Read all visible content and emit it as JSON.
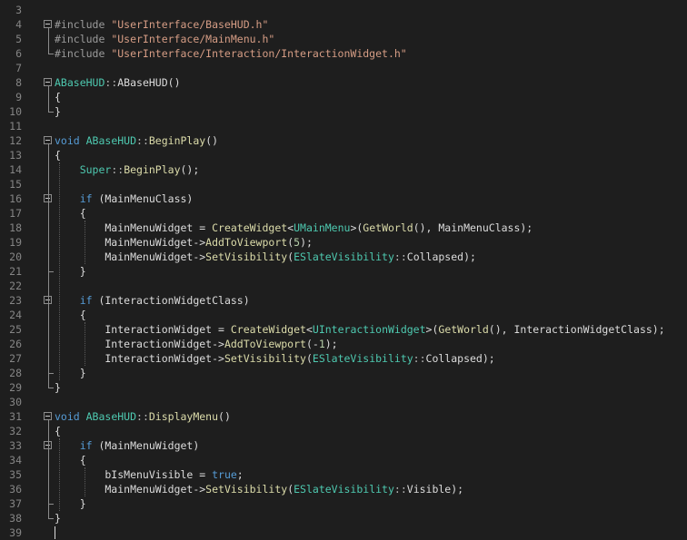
{
  "editor": {
    "lines": [
      {
        "num": "3",
        "segments": []
      },
      {
        "num": "4",
        "fold": true,
        "segments": [
          {
            "t": "#include ",
            "c": "pre"
          },
          {
            "t": "\"UserInterface/BaseHUD.h\"",
            "c": "str"
          }
        ]
      },
      {
        "num": "5",
        "segments": [
          {
            "t": "#include ",
            "c": "pre"
          },
          {
            "t": "\"UserInterface/MainMenu.h\"",
            "c": "str"
          }
        ]
      },
      {
        "num": "6",
        "segments": [
          {
            "t": "#include ",
            "c": "pre"
          },
          {
            "t": "\"UserInterface/Interaction/InteractionWidget.h\"",
            "c": "str"
          }
        ]
      },
      {
        "num": "7",
        "segments": []
      },
      {
        "num": "8",
        "fold": true,
        "segments": [
          {
            "t": "ABaseHUD",
            "c": "type"
          },
          {
            "t": "::",
            "c": "op"
          },
          {
            "t": "ABaseHUD",
            "c": "txt"
          },
          {
            "t": "()",
            "c": "txt"
          }
        ]
      },
      {
        "num": "9",
        "segments": [
          {
            "t": "{",
            "c": "txt"
          }
        ]
      },
      {
        "num": "10",
        "segments": [
          {
            "t": "}",
            "c": "txt"
          }
        ]
      },
      {
        "num": "11",
        "segments": []
      },
      {
        "num": "12",
        "fold": true,
        "segments": [
          {
            "t": "void ",
            "c": "kw"
          },
          {
            "t": "ABaseHUD",
            "c": "type"
          },
          {
            "t": "::",
            "c": "op"
          },
          {
            "t": "BeginPlay",
            "c": "fn"
          },
          {
            "t": "()",
            "c": "txt"
          }
        ]
      },
      {
        "num": "13",
        "segments": [
          {
            "t": "{",
            "c": "txt"
          }
        ]
      },
      {
        "num": "14",
        "segments": [
          {
            "t": "    ",
            "c": "txt"
          },
          {
            "t": "Super",
            "c": "type"
          },
          {
            "t": "::",
            "c": "op"
          },
          {
            "t": "BeginPlay",
            "c": "fn"
          },
          {
            "t": "();",
            "c": "txt"
          }
        ]
      },
      {
        "num": "15",
        "segments": []
      },
      {
        "num": "16",
        "fold": true,
        "segments": [
          {
            "t": "    ",
            "c": "txt"
          },
          {
            "t": "if",
            "c": "kw"
          },
          {
            "t": " (MainMenuClass)",
            "c": "txt"
          }
        ]
      },
      {
        "num": "17",
        "segments": [
          {
            "t": "    {",
            "c": "txt"
          }
        ]
      },
      {
        "num": "18",
        "segments": [
          {
            "t": "        MainMenuWidget = ",
            "c": "txt"
          },
          {
            "t": "CreateWidget",
            "c": "fn"
          },
          {
            "t": "<",
            "c": "txt"
          },
          {
            "t": "UMainMenu",
            "c": "type"
          },
          {
            "t": ">(",
            "c": "txt"
          },
          {
            "t": "GetWorld",
            "c": "fn"
          },
          {
            "t": "(), MainMenuClass);",
            "c": "txt"
          }
        ]
      },
      {
        "num": "19",
        "segments": [
          {
            "t": "        MainMenuWidget->",
            "c": "txt"
          },
          {
            "t": "AddToViewport",
            "c": "fn"
          },
          {
            "t": "(",
            "c": "txt"
          },
          {
            "t": "5",
            "c": "num"
          },
          {
            "t": ");",
            "c": "txt"
          }
        ]
      },
      {
        "num": "20",
        "segments": [
          {
            "t": "        MainMenuWidget->",
            "c": "txt"
          },
          {
            "t": "SetVisibility",
            "c": "fn"
          },
          {
            "t": "(",
            "c": "txt"
          },
          {
            "t": "ESlateVisibility",
            "c": "type"
          },
          {
            "t": "::",
            "c": "op"
          },
          {
            "t": "Collapsed",
            "c": "txt"
          },
          {
            "t": ");",
            "c": "txt"
          }
        ]
      },
      {
        "num": "21",
        "segments": [
          {
            "t": "    }",
            "c": "txt"
          }
        ]
      },
      {
        "num": "22",
        "segments": []
      },
      {
        "num": "23",
        "fold": true,
        "segments": [
          {
            "t": "    ",
            "c": "txt"
          },
          {
            "t": "if",
            "c": "kw"
          },
          {
            "t": " (InteractionWidgetClass)",
            "c": "txt"
          }
        ]
      },
      {
        "num": "24",
        "segments": [
          {
            "t": "    {",
            "c": "txt"
          }
        ]
      },
      {
        "num": "25",
        "segments": [
          {
            "t": "        InteractionWidget = ",
            "c": "txt"
          },
          {
            "t": "CreateWidget",
            "c": "fn"
          },
          {
            "t": "<",
            "c": "txt"
          },
          {
            "t": "UInteractionWidget",
            "c": "type"
          },
          {
            "t": ">(",
            "c": "txt"
          },
          {
            "t": "GetWorld",
            "c": "fn"
          },
          {
            "t": "(), InteractionWidgetClass);",
            "c": "txt"
          }
        ]
      },
      {
        "num": "26",
        "segments": [
          {
            "t": "        InteractionWidget->",
            "c": "txt"
          },
          {
            "t": "AddToViewport",
            "c": "fn"
          },
          {
            "t": "(-",
            "c": "txt"
          },
          {
            "t": "1",
            "c": "num"
          },
          {
            "t": ");",
            "c": "txt"
          }
        ]
      },
      {
        "num": "27",
        "segments": [
          {
            "t": "        InteractionWidget->",
            "c": "txt"
          },
          {
            "t": "SetVisibility",
            "c": "fn"
          },
          {
            "t": "(",
            "c": "txt"
          },
          {
            "t": "ESlateVisibility",
            "c": "type"
          },
          {
            "t": "::",
            "c": "op"
          },
          {
            "t": "Collapsed",
            "c": "txt"
          },
          {
            "t": ");",
            "c": "txt"
          }
        ]
      },
      {
        "num": "28",
        "segments": [
          {
            "t": "    }",
            "c": "txt"
          }
        ]
      },
      {
        "num": "29",
        "segments": [
          {
            "t": "}",
            "c": "txt"
          }
        ]
      },
      {
        "num": "30",
        "segments": []
      },
      {
        "num": "31",
        "fold": true,
        "segments": [
          {
            "t": "void ",
            "c": "kw"
          },
          {
            "t": "ABaseHUD",
            "c": "type"
          },
          {
            "t": "::",
            "c": "op"
          },
          {
            "t": "DisplayMenu",
            "c": "fn"
          },
          {
            "t": "()",
            "c": "txt"
          }
        ]
      },
      {
        "num": "32",
        "segments": [
          {
            "t": "{",
            "c": "txt"
          }
        ]
      },
      {
        "num": "33",
        "fold": true,
        "segments": [
          {
            "t": "    ",
            "c": "txt"
          },
          {
            "t": "if",
            "c": "kw"
          },
          {
            "t": " (MainMenuWidget)",
            "c": "txt"
          }
        ]
      },
      {
        "num": "34",
        "segments": [
          {
            "t": "    {",
            "c": "txt"
          }
        ]
      },
      {
        "num": "35",
        "segments": [
          {
            "t": "        bIsMenuVisible = ",
            "c": "txt"
          },
          {
            "t": "true",
            "c": "kw"
          },
          {
            "t": ";",
            "c": "txt"
          }
        ]
      },
      {
        "num": "36",
        "segments": [
          {
            "t": "        MainMenuWidget->",
            "c": "txt"
          },
          {
            "t": "SetVisibility",
            "c": "fn"
          },
          {
            "t": "(",
            "c": "txt"
          },
          {
            "t": "ESlateVisibility",
            "c": "type"
          },
          {
            "t": "::",
            "c": "op"
          },
          {
            "t": "Visible",
            "c": "txt"
          },
          {
            "t": ");",
            "c": "txt"
          }
        ]
      },
      {
        "num": "37",
        "segments": [
          {
            "t": "    }",
            "c": "txt"
          }
        ]
      },
      {
        "num": "38",
        "segments": [
          {
            "t": "}",
            "c": "txt"
          }
        ]
      },
      {
        "num": "39",
        "segments": []
      }
    ]
  }
}
